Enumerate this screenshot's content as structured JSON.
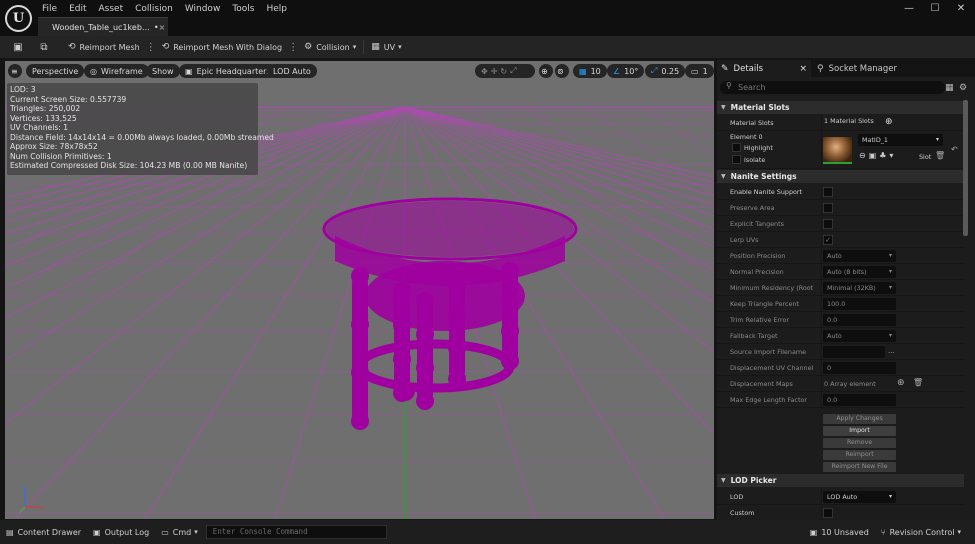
{
  "window": {
    "minimize": "—",
    "maximize": "☐",
    "close": "✕"
  },
  "menu": [
    "File",
    "Edit",
    "Asset",
    "Collision",
    "Window",
    "Tools",
    "Help"
  ],
  "asset_tab": {
    "label": "Wooden_Table_uc1keb…",
    "modified": "•",
    "close": "×"
  },
  "toolbar": {
    "reimport": "Reimport Mesh",
    "reimport_dialog": "Reimport Mesh With Dialog",
    "collision": "Collision",
    "uv": "UV"
  },
  "viewport": {
    "perspective": "Perspective",
    "wireframe": "Wireframe",
    "show": "Show",
    "headquarters": "Epic Headquarters",
    "lod": "LOD Auto",
    "grid_snap": "10",
    "rot_snap": "10°",
    "scale_snap": "0.25",
    "camera_speed": "1",
    "stats": [
      "LOD:  3",
      "Current Screen Size:  0.557739",
      "Triangles:  250,002",
      "Vertices:  133,525",
      "UV Channels:  1",
      "Distance Field:  14x14x14 = 0.00Mb always loaded, 0.00Mb streamed",
      "Approx Size: 78x78x52",
      "Num Collision Primitives:  1",
      "Estimated Compressed Disk Size: 104.23 MB (0.00 MB Nanite)"
    ],
    "colors": {
      "mesh": "#a000a0",
      "grid": "#b347b8"
    }
  },
  "details": {
    "tab_details": "Details",
    "tab_close": "×",
    "tab_socket": "Socket Manager",
    "search_placeholder": "Search",
    "material_slots": {
      "header": "Material Slots",
      "label": "Material Slots",
      "count": "1 Material Slots",
      "element": "Element 0",
      "highlight": "Highlight",
      "isolate": "Isolate",
      "material": "MatID_1",
      "slot": "Slot"
    },
    "nanite": {
      "header": "Nanite Settings",
      "enable": "Enable Nanite Support",
      "preserve": "Preserve Area",
      "explicit": "Explicit Tangents",
      "lerp": "Lerp UVs",
      "pos_precision": "Position Precision",
      "pos_precision_val": "Auto",
      "normal_precision": "Normal Precision",
      "normal_precision_val": "Auto (8 bits)",
      "min_residency": "Minimum Residency (Root Ge",
      "min_residency_val": "Minimal (32KB)",
      "keep_triangle": "Keep Triangle Percent",
      "keep_triangle_val": "100.0",
      "trim_error": "Trim Relative Error",
      "trim_error_val": "0.0",
      "fallback": "Fallback Target",
      "fallback_val": "Auto",
      "source_import": "Source Import Filename",
      "source_import_dots": "...",
      "disp_uv": "Displacement UV Channel",
      "disp_uv_val": "0",
      "disp_maps": "Displacement Maps",
      "disp_maps_val": "0 Array element",
      "max_edge": "Max Edge Length Factor",
      "max_edge_val": "0.0",
      "apply": "Apply Changes",
      "import": "Import",
      "remove": "Remove",
      "reimport": "Reimport",
      "reimport_new": "Reimport New File"
    },
    "lod_picker": {
      "header": "LOD Picker",
      "lod": "LOD",
      "lod_val": "LOD Auto",
      "custom": "Custom"
    }
  },
  "statusbar": {
    "content_drawer": "Content Drawer",
    "output_log": "Output Log",
    "cmd": "Cmd",
    "console_placeholder": "Enter Console Command",
    "unsaved": "10 Unsaved",
    "revision": "Revision Control"
  }
}
